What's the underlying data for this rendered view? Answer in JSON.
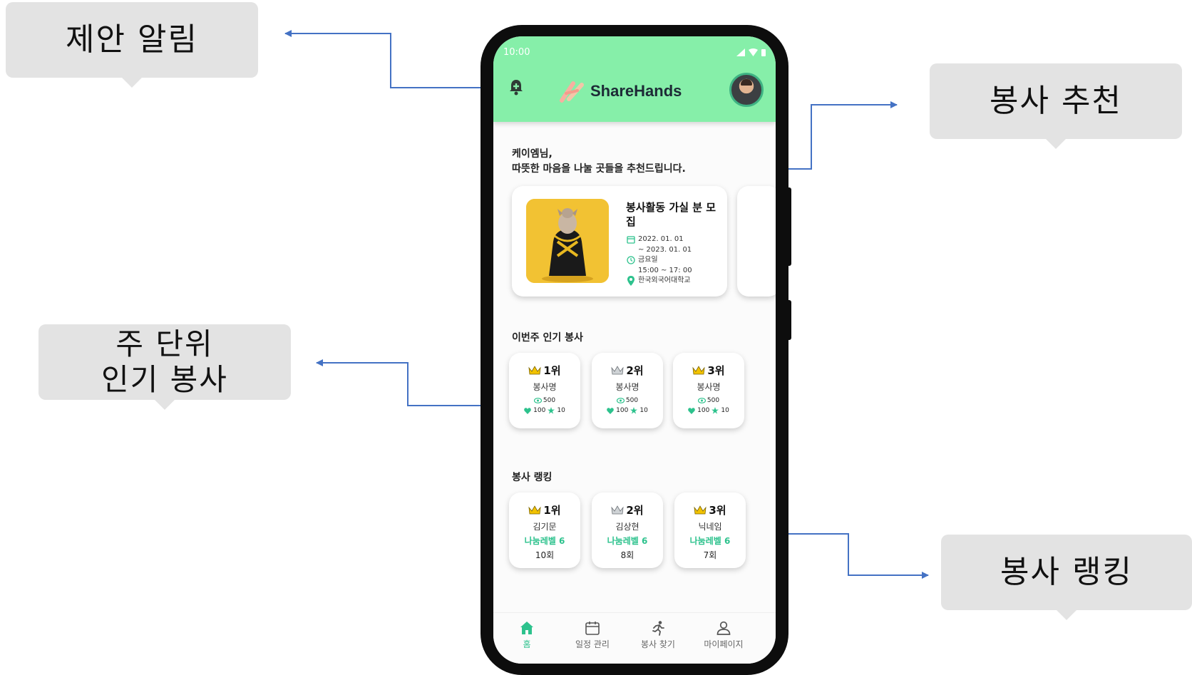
{
  "annotations": {
    "suggestion_alert": "제안 알림",
    "volunteer_recommend": "봉사 추천",
    "weekly_popular_line1": "주 단위",
    "weekly_popular_line2": "인기 봉사",
    "volunteer_ranking": "봉사 랭킹"
  },
  "status_bar": {
    "time": "10:00"
  },
  "header": {
    "brand": "ShareHands"
  },
  "greeting": {
    "line1": "케이엠님,",
    "line2": "따뜻한 마음을 나눌 곳들을 추천드립니다."
  },
  "recommend_card": {
    "title": "봉사활동 가실 분 모집",
    "date_start": "2022. 01. 01",
    "date_end": "~ 2023. 01. 01",
    "day": "금요일",
    "time": "15:00 ~ 17: 00",
    "place": "한국외국어대학교"
  },
  "popular": {
    "title": "이번주 인기 봉사",
    "items": [
      {
        "rank": "1위",
        "name": "봉사명",
        "views": "500",
        "likes": "100",
        "stars": "10"
      },
      {
        "rank": "2위",
        "name": "봉사명",
        "views": "500",
        "likes": "100",
        "stars": "10"
      },
      {
        "rank": "3위",
        "name": "봉사명",
        "views": "500",
        "likes": "100",
        "stars": "10"
      }
    ]
  },
  "ranking": {
    "title": "봉사 랭킹",
    "items": [
      {
        "rank": "1위",
        "name": "김기문",
        "level": "나눔레벨 6",
        "count": "10회"
      },
      {
        "rank": "2위",
        "name": "김상현",
        "level": "나눔레벨 6",
        "count": "8회"
      },
      {
        "rank": "3위",
        "name": "닉네임",
        "level": "나눔레벨 6",
        "count": "7회"
      }
    ]
  },
  "bottom_nav": {
    "home": "홈",
    "schedule": "일정 관리",
    "find": "봉사 찾기",
    "mypage": "마이페이지"
  },
  "colors": {
    "appbar": "#86efa9",
    "accent": "#2dc28d",
    "connector": "#4472c4",
    "callout": "#e3e3e3",
    "gold_crown": "#f2c200",
    "silver_crown": "#9aa0a6"
  },
  "icons": [
    "bell-icon",
    "handshake-logo-icon",
    "calendar-icon",
    "clock-icon",
    "location-pin-icon",
    "crown-icon",
    "eye-icon",
    "heart-icon",
    "star-icon",
    "home-icon",
    "calendar-nav-icon",
    "running-person-icon",
    "person-icon"
  ]
}
